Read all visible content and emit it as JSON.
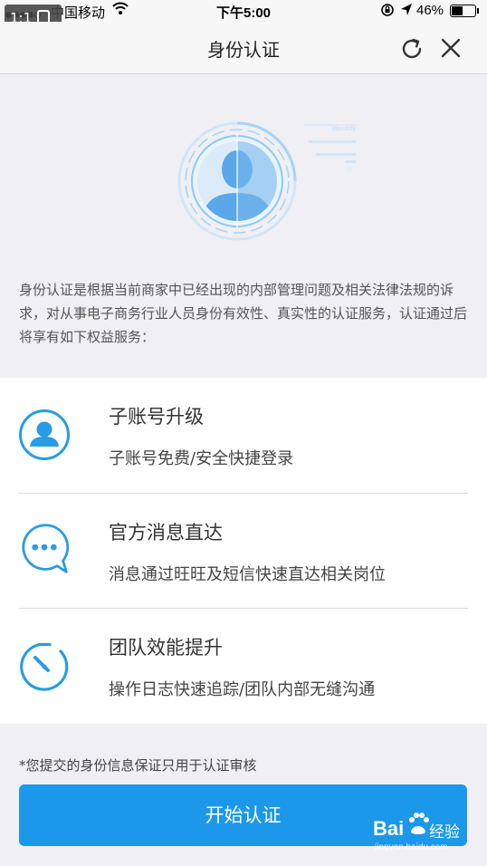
{
  "status_bar": {
    "carrier": "中国移动",
    "time": "下午5:00",
    "battery": "46%",
    "battery_level": 0.46
  },
  "zoom_badge": {
    "label": "1:1"
  },
  "header": {
    "title": "身份认证"
  },
  "hero": {
    "label": "Identify"
  },
  "intro": "身份认证是根据当前商家中已经出现的内部管理问题及相关法律法规的诉求，对从事电子商务行业人员身份有效性、真实性的认证服务，认证通过后将享有如下权益服务：",
  "benefits": [
    {
      "title": "子账号升级",
      "desc": "子账号免费/安全快捷登录",
      "icon": "user-icon"
    },
    {
      "title": "官方消息直达",
      "desc": "消息通过旺旺及短信快速直达相关岗位",
      "icon": "chat-bubble-icon"
    },
    {
      "title": "团队效能提升",
      "desc": "操作日志快速追踪/团队内部无缝沟通",
      "icon": "timer-icon"
    }
  ],
  "footer": {
    "note": "*您提交的身份信息保证只用于认证审核",
    "button": "开始认证"
  },
  "watermark": {
    "brand": "Bai",
    "suffix": "经验",
    "url": "jingyan.baidu.com"
  },
  "colors": {
    "accent": "#1b98ea",
    "icon_blue": "#2a9be6",
    "background": "#efeff4"
  }
}
